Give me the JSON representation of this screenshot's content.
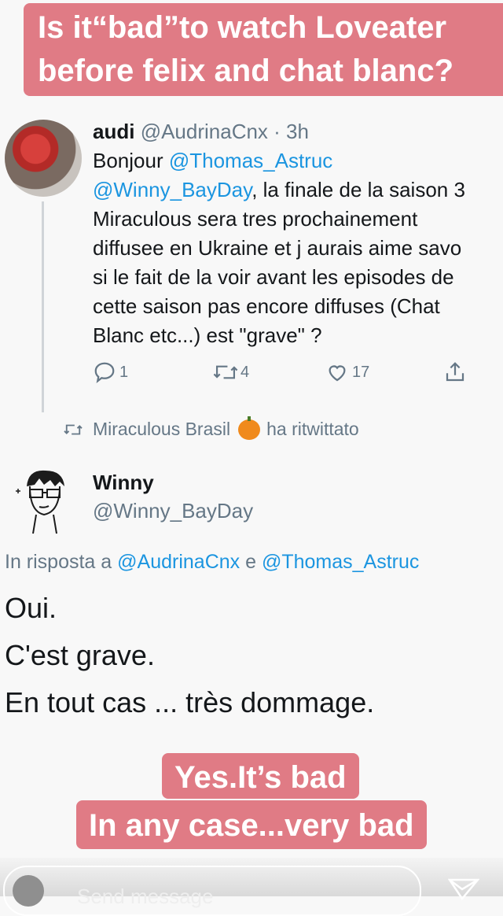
{
  "captions": {
    "top_line1": "Is it“bad”to watch Loveater",
    "top_line2": "before felix and chat blanc?",
    "bottom_line1": "Yes.It’s bad",
    "bottom_line2": "In any case...very bad"
  },
  "tweet1": {
    "name": "audi",
    "handle": "@AudrinaCnx",
    "separator": " · ",
    "time": "3h",
    "body": {
      "l1_text": "Bonjour ",
      "l1_mention": "@Thomas_Astruc",
      "l2_mention": "@Winny_BayDay",
      "l2_text": ", la finale de la saison 3",
      "l3": "Miraculous sera tres prochainement",
      "l4": "diffusee en Ukraine et j aurais aime savo",
      "l5": "si le fait de la voir avant les episodes de",
      "l6": "cette saison pas encore diffuses (Chat",
      "l7": "Blanc etc...) est \"grave\" ?"
    },
    "replies": "1",
    "retweets": "4",
    "likes": "17",
    "icons": [
      "reply-icon",
      "retweet-icon",
      "like-icon",
      "share-icon"
    ]
  },
  "retweet_notice": {
    "account": "Miraculous Brasil",
    "suffix": "ha ritwittato",
    "emoji": "pumpkin-icon"
  },
  "tweet2": {
    "name": "Winny",
    "handle": "@Winny_BayDay",
    "reply_prefix": "In risposta a ",
    "reply_user1": "@AudrinaCnx",
    "reply_join": " e ",
    "reply_user2": "@Thomas_Astruc",
    "line1": "Oui.",
    "line2": "C'est grave.",
    "line3": "En tout cas ... très dommage."
  },
  "story_bar": {
    "message_placeholder": "Send message",
    "icons": [
      "camera-icon",
      "send-icon"
    ]
  },
  "colors": {
    "caption_bg": "#e07b85",
    "link": "#1b95e0",
    "muted": "#657786"
  }
}
